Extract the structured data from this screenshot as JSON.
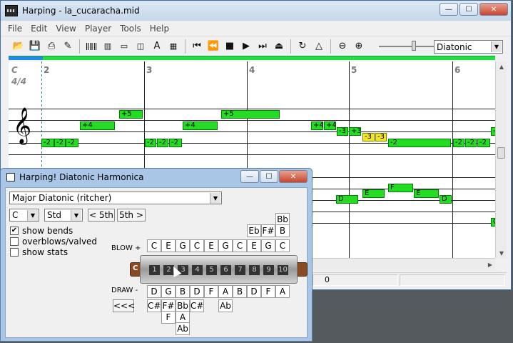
{
  "window": {
    "title": "Harping - la_cucaracha.mid",
    "controls": {
      "minimize": "—",
      "maximize": "☐",
      "close": "✕"
    }
  },
  "menu": [
    "File",
    "Edit",
    "View",
    "Player",
    "Tools",
    "Help"
  ],
  "toolbar": {
    "icons": [
      "open-icon",
      "save-icon",
      "print-icon",
      "edit-icon",
      "harmonica-icon",
      "keyboard-icon",
      "view-icon",
      "tape-icon",
      "font-icon",
      "table-icon",
      "skip-back-icon",
      "rewind-icon",
      "stop-icon",
      "play-icon",
      "skip-forward-icon",
      "eject-icon",
      "loop-icon",
      "metronome-icon",
      "zoom-out-icon",
      "zoom-in-icon"
    ],
    "mode_select": "Diatonic"
  },
  "playback": {
    "progress_fraction": 0.07
  },
  "score": {
    "key": "C",
    "time_signature": "4/4",
    "measures": [
      "2",
      "3",
      "4",
      "5",
      "6"
    ],
    "notes": [
      {
        "label": "-2",
        "active": false
      },
      {
        "label": "-2",
        "active": false
      },
      {
        "label": "-2",
        "active": false
      },
      {
        "label": "+4",
        "active": false
      },
      {
        "label": "+5",
        "active": false
      },
      {
        "label": "-2",
        "active": false
      },
      {
        "label": "-2",
        "active": false
      },
      {
        "label": "-2",
        "active": false
      },
      {
        "label": "+4",
        "active": false
      },
      {
        "label": "+5",
        "active": false
      },
      {
        "label": "+4",
        "active": false
      },
      {
        "label": "+4",
        "active": false
      },
      {
        "label": "-3",
        "active": false
      },
      {
        "label": "+3",
        "active": false
      },
      {
        "label": "-3",
        "active": true
      },
      {
        "label": "-3",
        "active": true
      },
      {
        "label": "-2",
        "active": false
      },
      {
        "label": "-2",
        "active": false
      },
      {
        "label": "-2",
        "active": false
      },
      {
        "label": "-2",
        "active": false
      },
      {
        "label": "-",
        "active": false
      },
      {
        "label": "D",
        "active": false
      },
      {
        "label": "E",
        "active": false
      },
      {
        "label": "F",
        "active": false
      },
      {
        "label": "E",
        "active": false
      },
      {
        "label": "D",
        "active": false
      },
      {
        "label": "C",
        "active": false
      }
    ]
  },
  "status": {
    "value": "0"
  },
  "dialog": {
    "title": "Harping! Diatonic Harmonica",
    "scale_select": "Major Diatonic (ritcher)",
    "key_select": "C",
    "tuning_select": "Std",
    "prev_position": "< 5th",
    "next_position": "5th >",
    "options": [
      {
        "label": "show bends",
        "checked": true
      },
      {
        "label": "overblows/valved",
        "checked": false
      },
      {
        "label": "show stats",
        "checked": false
      }
    ],
    "blow_label": "BLOW +",
    "draw_label": "DRAW -",
    "harp_key": "C",
    "holes": [
      "1",
      "2",
      "3",
      "4",
      "5",
      "6",
      "7",
      "8",
      "9",
      "10"
    ],
    "blow_notes": [
      "C",
      "E",
      "G",
      "C",
      "E",
      "G",
      "C",
      "E",
      "G",
      "C"
    ],
    "blow_bends_row1": [
      "Eb",
      "F#",
      "B"
    ],
    "blow_bends_top": "Bb",
    "draw_notes": [
      "D",
      "G",
      "B",
      "D",
      "F",
      "A",
      "B",
      "D",
      "F",
      "A"
    ],
    "draw_bends_row1": [
      "C#",
      "F#",
      "Bb",
      "C#",
      "Ab"
    ],
    "draw_bends_row2": [
      "F",
      "A"
    ],
    "draw_bends_row3": "Ab",
    "back_button": "<<<"
  }
}
